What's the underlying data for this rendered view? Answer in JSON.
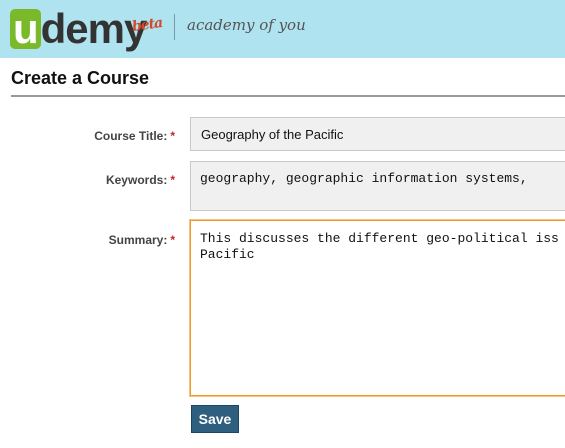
{
  "header": {
    "logo_u": "u",
    "logo_rest": "demy",
    "logo_beta": "beta",
    "tagline": "academy of you"
  },
  "page": {
    "title": "Create a Course"
  },
  "form": {
    "required_marker": "*",
    "course_title": {
      "label": "Course Title:",
      "value": "Geography of the Pacific"
    },
    "keywords": {
      "label": "Keywords:",
      "value": "geography, geographic information systems,"
    },
    "summary": {
      "label": "Summary:",
      "value": "This discusses the different geo-political iss\nPacific"
    },
    "save_label": "Save"
  },
  "colors": {
    "header_bg": "#aee3ef",
    "logo_green": "#7ab929",
    "beta_red": "#d24a2d",
    "focus_orange": "#f09a2c",
    "button_blue": "#2f5f7e",
    "required_red": "#cc2222"
  }
}
